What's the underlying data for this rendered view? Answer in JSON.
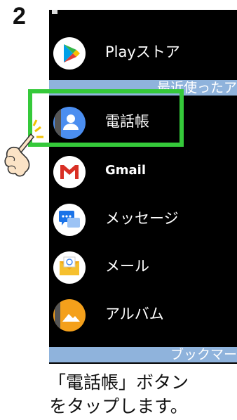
{
  "step_number": "2",
  "apps": [
    {
      "label": "Playストア",
      "icon": "play-store-icon"
    },
    {
      "label": "電話帳",
      "icon": "contacts-icon"
    },
    {
      "label": "Gmail",
      "icon": "gmail-icon"
    },
    {
      "label": "メッセージ",
      "icon": "messages-icon"
    },
    {
      "label": "メール",
      "icon": "mail-icon"
    },
    {
      "label": "アルバム",
      "icon": "album-icon"
    }
  ],
  "sections": {
    "recent": "最近使ったア",
    "bookmarks": "ブックマー"
  },
  "caption": {
    "line1": "「電話帳」ボタン",
    "line2": "をタップします。"
  },
  "colors": {
    "highlight": "#35c93a",
    "section_bg": "#8fb3dc",
    "screen_bg": "#000000"
  }
}
